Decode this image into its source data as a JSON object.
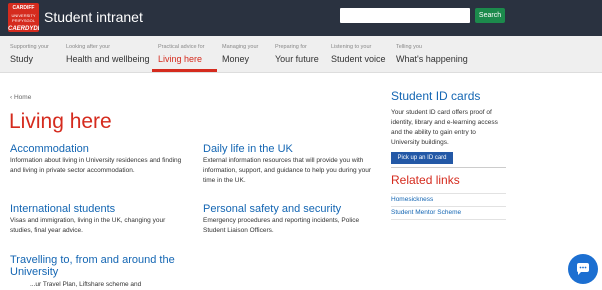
{
  "header": {
    "logo_lines": [
      "CARDIFF",
      "UNIVERSITY PRIFYSGOL",
      "CAERDYDD"
    ],
    "app_title": "Student intranet",
    "search_placeholder": "",
    "search_button": "Search"
  },
  "nav": {
    "items": [
      {
        "sub": "Supporting your",
        "label": "Study"
      },
      {
        "sub": "Looking after your",
        "label": "Health and wellbeing"
      },
      {
        "sub": "Practical advice for",
        "label": "Living here"
      },
      {
        "sub": "Managing your",
        "label": "Money"
      },
      {
        "sub": "Preparing for",
        "label": "Your future"
      },
      {
        "sub": "Listening to your",
        "label": "Student voice"
      },
      {
        "sub": "Telling you",
        "label": "What's happening"
      }
    ]
  },
  "breadcrumb": "Home",
  "page_title": "Living here",
  "sections": [
    {
      "title": "Accommodation",
      "desc": "Information about living in University residences and finding and living in private sector accommodation."
    },
    {
      "title": "Daily life in the UK",
      "desc": "External information resources that will provide you with information, support, and guidance to help you during your time in the UK."
    },
    {
      "title": "International students",
      "desc": "Visas and immigration, living in the UK, changing your studies, final year advice."
    },
    {
      "title": "Personal safety and security",
      "desc": "Emergency procedures and reporting incidents, Police Student Liaison Officers."
    },
    {
      "title": "Travelling to, from and around the University",
      "desc": "...ur Travel Plan, Liftshare scheme and"
    }
  ],
  "sidebar": {
    "id_title": "Student ID cards",
    "id_desc": "Your student ID card offers proof of identity, library and e-learning access and the ability to gain entry to University buildings.",
    "id_button": "Pick up an ID card",
    "related_title": "Related links",
    "links": [
      "Homesickness",
      "Student Mentor Scheme"
    ]
  },
  "colors": {
    "accent": "#d52b1e",
    "link": "#1466b3",
    "header_bg": "#2a3240",
    "search_btn": "#1c8a4c",
    "chat": "#1c6fd1"
  },
  "icons": {
    "chat": "chat-bubble-icon",
    "breadcrumb": "chevron-left-icon"
  }
}
